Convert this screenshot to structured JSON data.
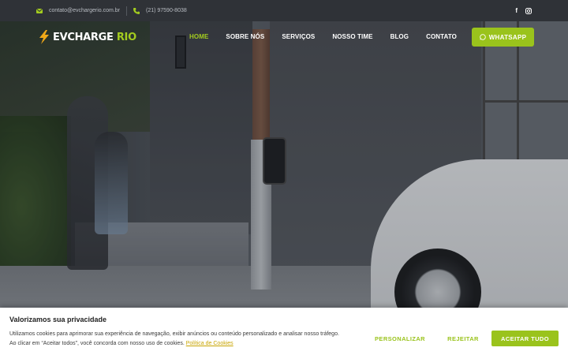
{
  "topbar": {
    "email": "contato@evchargerio.com.br",
    "phone": "(21) 97590-8038",
    "social": [
      {
        "icon": "facebook-icon",
        "glyph": "f"
      },
      {
        "icon": "instagram-icon",
        "glyph": "◎"
      }
    ]
  },
  "header": {
    "logo_main": "EVCHARGE",
    "logo_accent": " RIO",
    "nav": [
      {
        "label": "HOME",
        "active": true
      },
      {
        "label": "SOBRE NÓS",
        "active": false
      },
      {
        "label": "SERVIÇOS",
        "active": false
      },
      {
        "label": "NOSSO TIME",
        "active": false
      },
      {
        "label": "BLOG",
        "active": false
      },
      {
        "label": "CONTATO",
        "active": false
      }
    ],
    "whatsapp_label": "WHATSAPP"
  },
  "cookie": {
    "title": "Valorizamos sua privacidade",
    "text_line1": "Utilizamos cookies para aprimorar sua experiência de navegação, exibir anúncios ou conteúdo personalizado e analisar nosso tráfego.",
    "text_line2": "Ao clicar em “Aceitar todos”, você concorda com nosso uso de cookies.",
    "policy_link": "Política de Cookies",
    "customize_label": "PERSONALIZAR",
    "reject_label": "REJEITAR",
    "accept_label": "ACEITAR TUDO"
  },
  "colors": {
    "accent": "#9ac31c",
    "accent_light": "#a3cc1f",
    "topbar_bg": "#2f3237",
    "link": "#c8a400"
  }
}
